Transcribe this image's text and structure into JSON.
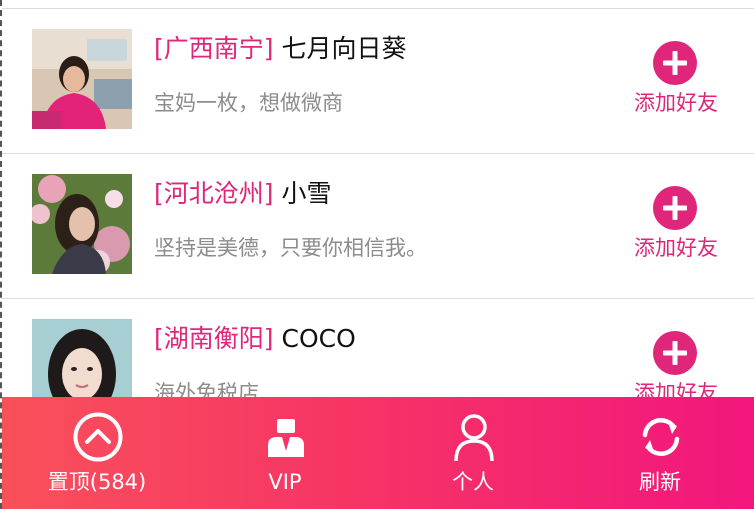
{
  "colors": {
    "accent": "#e0267b",
    "bar_start": "#f9505a",
    "bar_end": "#f2167d",
    "text_muted": "#8c8c8c"
  },
  "friends": [
    {
      "region": "[广西南宁]",
      "nickname": "七月向日葵",
      "signature": "宝妈一枚，想做微商",
      "action_label": "添加好友",
      "action_icon": "plus-circle-icon"
    },
    {
      "region": "[河北沧州]",
      "nickname": "小雪",
      "signature": "坚持是美德，只要你相信我。",
      "action_label": "添加好友",
      "action_icon": "plus-circle-icon"
    },
    {
      "region": "[湖南衡阳]",
      "nickname": "COCO",
      "signature": "海外免税店",
      "action_label": "添加好友",
      "action_icon": "plus-circle-icon"
    }
  ],
  "tabbar": {
    "items": [
      {
        "label": "置顶(584)",
        "icon": "chevron-up-circle-icon"
      },
      {
        "label": "VIP",
        "icon": "vip-person-icon"
      },
      {
        "label": "个人",
        "icon": "user-icon"
      },
      {
        "label": "刷新",
        "icon": "refresh-icon"
      }
    ]
  }
}
